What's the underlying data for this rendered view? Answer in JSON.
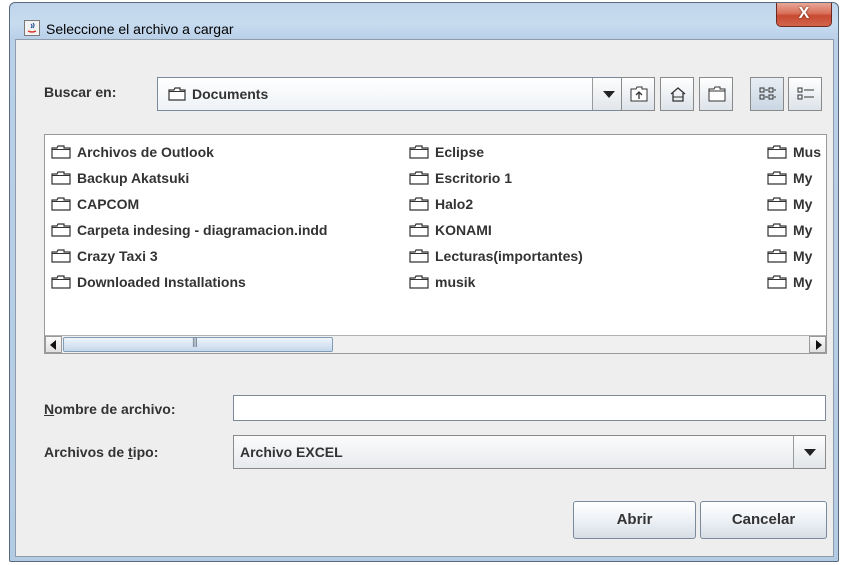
{
  "window": {
    "title": "Seleccione el archivo a cargar",
    "close_glyph": "X"
  },
  "look_in": {
    "label": "Buscar en:",
    "selected": "Documents"
  },
  "toolbar": {
    "icons": [
      "up-one-level-icon",
      "home-icon",
      "new-folder-icon",
      "list-view-icon",
      "details-view-icon"
    ]
  },
  "files": {
    "column1": [
      "Archivos de Outlook",
      "Backup Akatsuki",
      "CAPCOM",
      "Carpeta indesing - diagramacion.indd",
      "Crazy Taxi 3",
      "Downloaded Installations"
    ],
    "column2": [
      "Eclipse",
      "Escritorio 1",
      "Halo2",
      "KONAMI",
      "Lecturas(importantes)",
      "musik"
    ],
    "column3": [
      "Mus",
      "My",
      "My",
      "My",
      "My",
      "My"
    ]
  },
  "file_name": {
    "label_first": "N",
    "label_rest": "ombre de archivo:",
    "value": ""
  },
  "file_type": {
    "label_before": "Archivos de ",
    "label_underline": "t",
    "label_after": "ipo:",
    "selected": "Archivo EXCEL"
  },
  "buttons": {
    "open": "Abrir",
    "cancel": "Cancelar"
  }
}
